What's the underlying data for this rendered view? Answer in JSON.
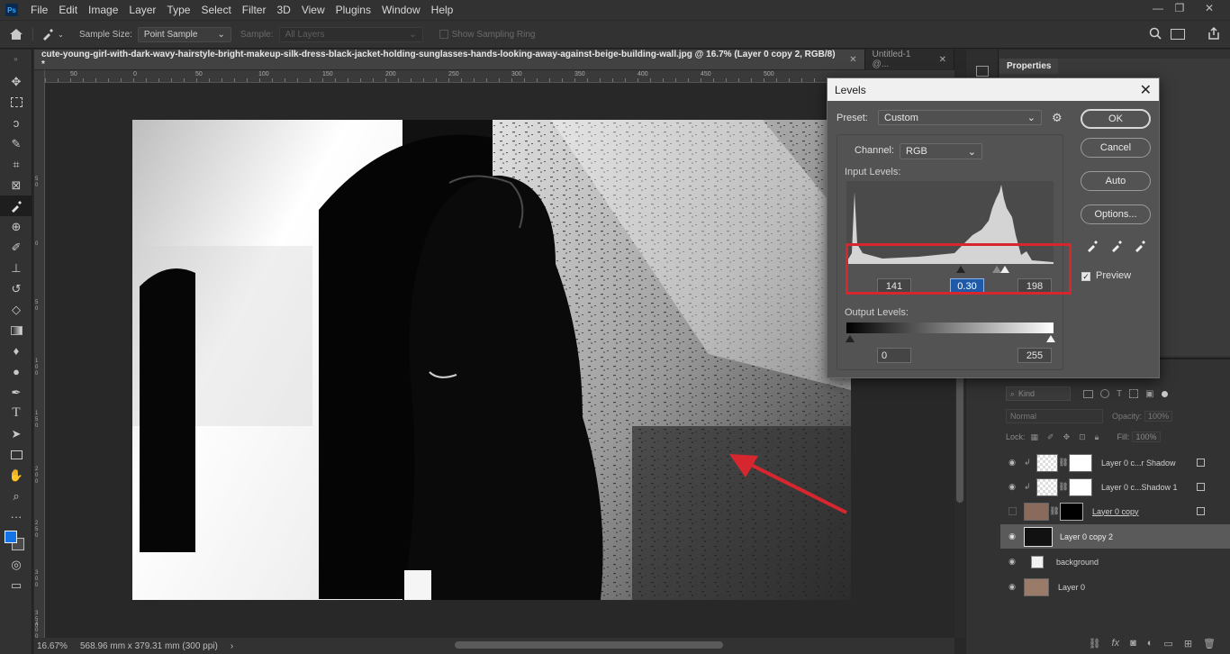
{
  "menu": {
    "logo": "Ps",
    "items": [
      "File",
      "Edit",
      "Image",
      "Layer",
      "Type",
      "Select",
      "Filter",
      "3D",
      "View",
      "Plugins",
      "Window",
      "Help"
    ],
    "window_controls": [
      "—",
      "❐",
      "✕"
    ]
  },
  "options": {
    "sample_size_label": "Sample Size:",
    "sample_size_value": "Point Sample",
    "sample_label": "Sample:",
    "sample_value": "All Layers",
    "show_ring_label": "Show Sampling Ring"
  },
  "tabs": {
    "active": "cute-young-girl-with-dark-wavy-hairstyle-bright-makeup-silk-dress-black-jacket-holding-sunglasses-hands-looking-away-against-beige-building-wall.jpg @ 16.7% (Layer 0 copy 2, RGB/8) *",
    "second": "Untitled-1 @..."
  },
  "ruler_top": [
    "50",
    "0",
    "50",
    "100",
    "150",
    "200",
    "250",
    "300",
    "350",
    "400",
    "450",
    "500"
  ],
  "ruler_left": [
    "5 0",
    "0",
    "5 0",
    "1 0 0",
    "1 5 0",
    "2 0 0",
    "2 5 0",
    "3 0 0",
    "3 5 0",
    "4 0 0"
  ],
  "status": {
    "zoom": "16.67%",
    "doc_size": "568.96 mm x 379.31 mm (300 ppi)"
  },
  "properties": {
    "title": "Properties"
  },
  "layers_panel": {
    "kind_placeholder": "Kind",
    "blend_mode": "Normal",
    "opacity_label": "Opacity:",
    "opacity_value": "100%",
    "lock_label": "Lock:",
    "fill_label": "Fill:",
    "fill_value": "100%",
    "layers": [
      {
        "name": "Layer 0 c...r Shadow",
        "visible": true
      },
      {
        "name": "Layer 0 c...Shadow 1",
        "visible": true
      },
      {
        "name": "Layer 0 copy",
        "visible": false
      },
      {
        "name": "Layer 0 copy 2",
        "visible": true,
        "selected": true
      },
      {
        "name": "background",
        "visible": true
      },
      {
        "name": "Layer 0",
        "visible": true
      }
    ]
  },
  "levels": {
    "title": "Levels",
    "preset_label": "Preset:",
    "preset_value": "Custom",
    "channel_label": "Channel:",
    "channel_value": "RGB",
    "input_label": "Input Levels:",
    "input_black": "141",
    "input_gamma": "0.30",
    "input_white": "198",
    "output_label": "Output Levels:",
    "output_black": "0",
    "output_white": "255",
    "ok": "OK",
    "cancel": "Cancel",
    "auto": "Auto",
    "options": "Options...",
    "preview_label": "Preview",
    "preview_checked": true
  },
  "colors": {
    "highlight_box": "#d6272e",
    "arrow": "#d6272e",
    "foreground": "#1473e6"
  }
}
